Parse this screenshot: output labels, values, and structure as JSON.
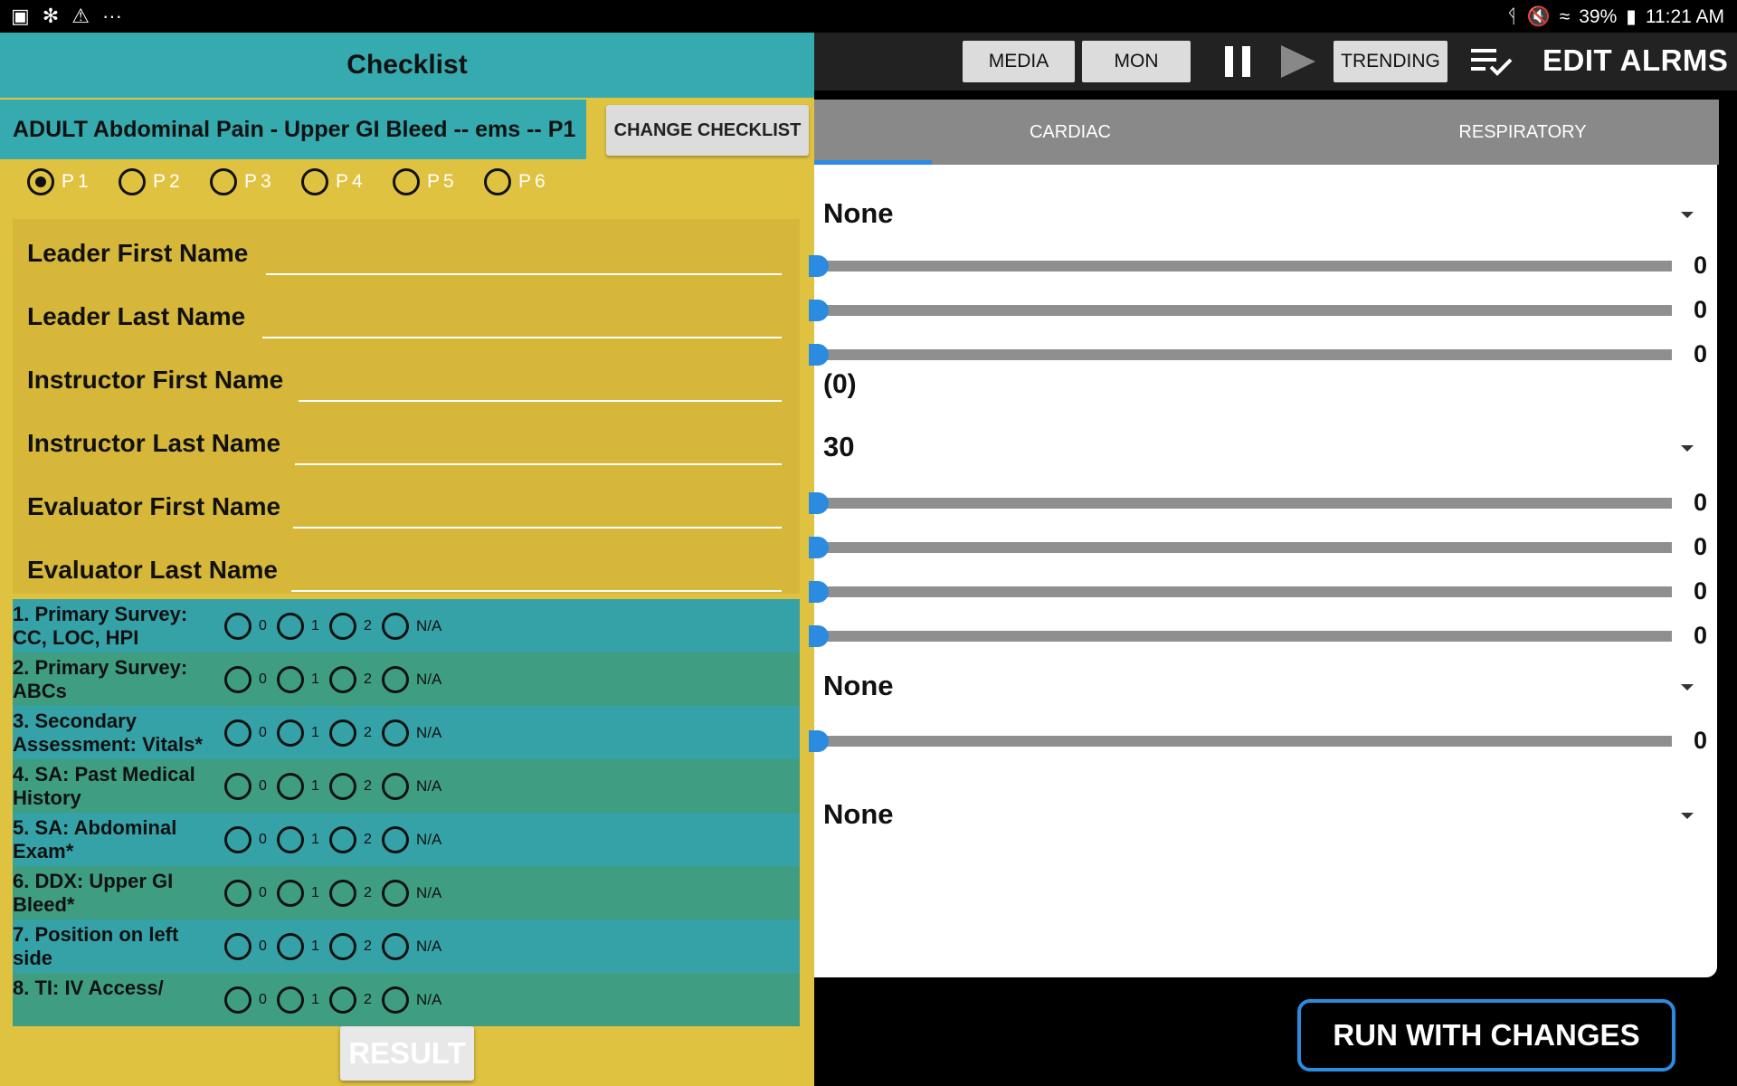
{
  "status_bar": {
    "battery": "39%",
    "time": "11:21 AM",
    "more": "···"
  },
  "checklist": {
    "title": "Checklist",
    "name": "ADULT Abdominal Pain - Upper GI Bleed -- ems -- P1",
    "change_button": "CHANGE CHECKLIST",
    "patient_options": [
      "P1",
      "P2",
      "P3",
      "P4",
      "P5",
      "P6"
    ],
    "selected_patient": "P1",
    "fields": [
      "Leader First Name",
      "Leader Last Name",
      "Instructor First Name",
      "Instructor Last Name",
      "Evaluator First Name",
      "Evaluator Last Name"
    ],
    "score_options": [
      "0",
      "1",
      "2",
      "N/A"
    ],
    "items": [
      "1. Primary Survey: CC, LOC, HPI",
      "2. Primary Survey: ABCs",
      "3. Secondary Assessment: Vitals*",
      "4. SA: Past Medical History",
      "5. SA: Abdominal Exam*",
      "6. DDX: Upper GI Bleed*",
      "7. Position on left side",
      "8. TI: IV Access/"
    ],
    "result_button": "RESULT"
  },
  "toolbar": {
    "media": "MEDIA",
    "mon": "MON",
    "trending": "TRENDING",
    "edit_alarms": "EDIT ALRMS"
  },
  "tabs": [
    "CARDIAC",
    "RESPIRATORY"
  ],
  "cardiac": {
    "dropdown_1": "None",
    "slider_values_1": [
      0,
      0,
      0
    ],
    "paren_value": "(0)",
    "dropdown_2": "30",
    "slider_values_2": [
      0,
      0,
      0,
      0
    ],
    "dropdown_3": "None",
    "slider_values_3": [
      0
    ],
    "dropdown_4": "None"
  },
  "run_button": "RUN WITH CHANGES",
  "colors": {
    "teal": "#35aaaf",
    "yellow": "#e0c241",
    "accent_blue": "#2b8be0"
  }
}
